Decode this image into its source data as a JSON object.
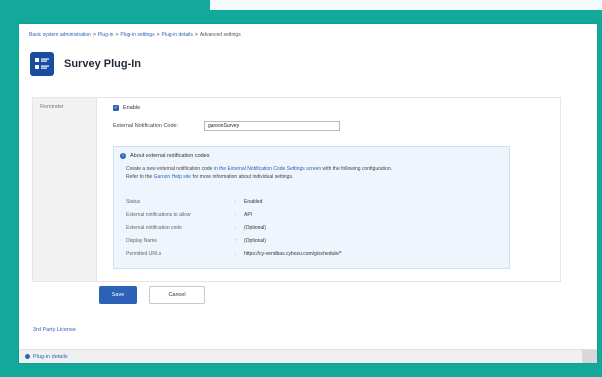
{
  "breadcrumb": {
    "items": [
      "Basic system administration",
      "Plug-in",
      "Plug-in settings",
      "Plug-in details",
      "Advanced settings"
    ],
    "separator": ">"
  },
  "app": {
    "title": "Survey Plug-In",
    "icon": "survey-form-icon"
  },
  "section": {
    "label": "Reminder"
  },
  "enable": {
    "checked": true,
    "label": "Enable"
  },
  "notification_code": {
    "label": "External Notification Code:",
    "value": "garoonSurvey"
  },
  "info": {
    "icon": "info-icon",
    "title": "About external notification codes",
    "description_prefix": "Create a new external notification code",
    "description_link": "in the External Notification Code Settings screen",
    "description_suffix": "with the following configuration.",
    "refer_prefix": "Refer to the",
    "refer_link": "Garoon Help site",
    "refer_suffix": "for more information about individual settings.",
    "rows": [
      {
        "key": "Status",
        "value": "Enabled"
      },
      {
        "key": "External notifications to allow",
        "value": "API"
      },
      {
        "key": "External notification code",
        "value": "(Optional)"
      },
      {
        "key": "Display Name",
        "value": "(Optional)"
      },
      {
        "key": "Permitted URLs",
        "value": "https://cy-vendbas.cybozu.com/g/schedule/*"
      }
    ]
  },
  "buttons": {
    "save": "Save",
    "cancel": "Cancel"
  },
  "third_party": "3rd Party License",
  "footer": {
    "link": "Plug-in details"
  },
  "colors": {
    "background": "#12a99b",
    "accent": "#2c62b8",
    "app_icon": "#1a4da0"
  }
}
